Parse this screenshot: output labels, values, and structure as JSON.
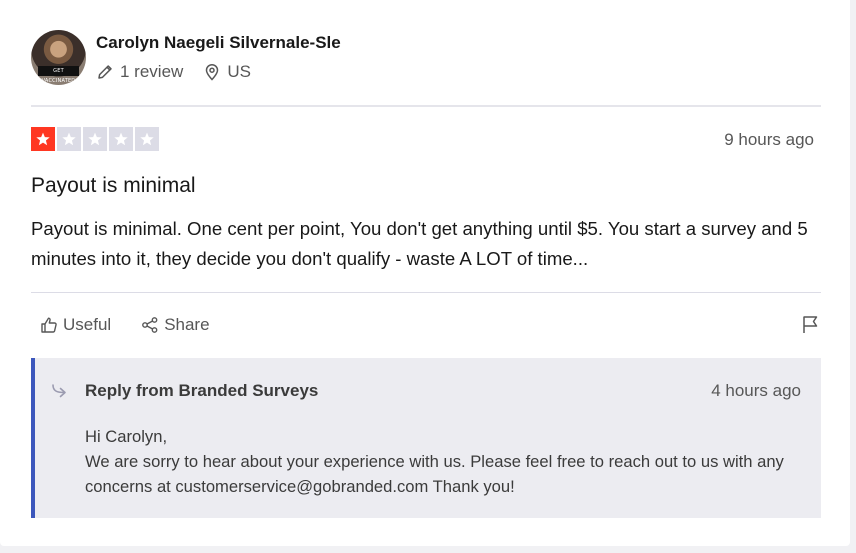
{
  "author": {
    "name": "Carolyn Naegeli Silvernale-Sle",
    "avatar_badge": "GET VACCINATED",
    "review_count": "1 review",
    "country": "US"
  },
  "review": {
    "rating": 1,
    "max_rating": 5,
    "rating_color": "#ff3722",
    "empty_star_color": "#dcdce6",
    "date": "9 hours ago",
    "title": "Payout is minimal",
    "body": "Payout is minimal. One cent per point, You don't get anything until $5. You start a survey and 5 minutes into it, they decide you don't qualify - waste A LOT of time..."
  },
  "actions": {
    "useful_label": "Useful",
    "share_label": "Share",
    "flag_icon": "flag-icon"
  },
  "reply": {
    "from": "Reply from Branded Surveys",
    "date": "4 hours ago",
    "greeting": "Hi Carolyn,",
    "message": "We are sorry to hear about your experience with us. Please feel free to reach out to us with any concerns at customerservice@gobranded.com Thank you!",
    "accent_color": "#3c57bc"
  }
}
